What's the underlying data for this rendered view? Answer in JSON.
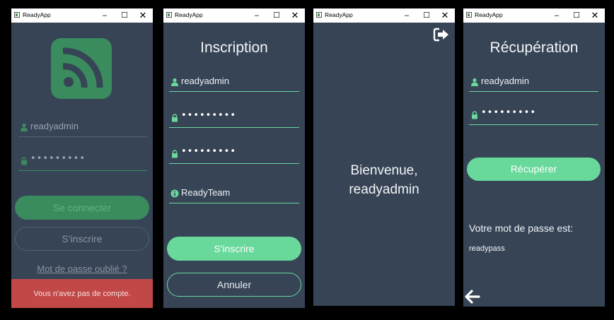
{
  "windows": [
    {
      "title": "ReadyApp",
      "username": "readyadmin",
      "password_mask": "•••••••••",
      "login_label": "Se connecter",
      "register_label": "S'inscrire",
      "forgot_label": "Mot de passe oublié ?",
      "banner_text": "Vous n'avez pas de compte."
    },
    {
      "title": "ReadyApp",
      "heading": "Inscription",
      "username": "readyadmin",
      "password_mask": "•••••••••",
      "confirm_mask": "•••••••••",
      "team": "ReadyTeam",
      "register_label": "S'inscrire",
      "cancel_label": "Annuler"
    },
    {
      "title": "ReadyApp",
      "welcome_line1": "Bienvenue,",
      "welcome_line2": "readyadmin"
    },
    {
      "title": "ReadyApp",
      "heading": "Récupération",
      "username": "readyadmin",
      "password_mask": "•••••••••",
      "recover_label": "Récupérer",
      "result_label": "Votre mot de passe est:",
      "result_value": "readypass"
    }
  ],
  "titlebar_controls": {
    "minimize": "–",
    "maximize": "☐",
    "close": "✕"
  },
  "colors": {
    "accent": "#68d89b",
    "background": "#374456",
    "banner": "#c24848"
  },
  "icons": {
    "app_logo": "rss-icon",
    "user_field": "user-icon",
    "password_field": "lock-icon",
    "team_field": "info-icon",
    "logout": "logout-icon",
    "back": "arrow-left-icon"
  }
}
